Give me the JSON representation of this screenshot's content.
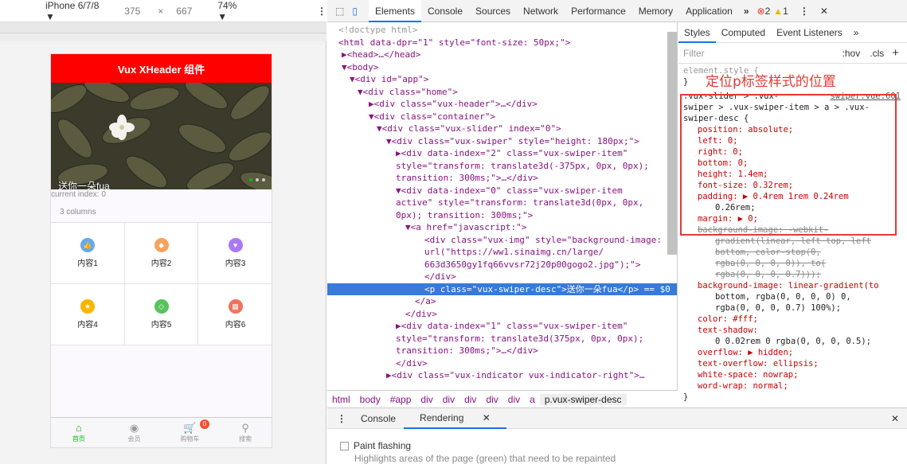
{
  "device_toolbar": {
    "device": "iPhone 6/7/8",
    "width": "375",
    "times": "×",
    "height": "667",
    "zoom": "74%",
    "more": "⋮"
  },
  "phone": {
    "header_title": "Vux XHeader 组件",
    "swiper_desc": "送你一朵fua",
    "current_index": "current index: 0",
    "columns_title": "3 columns",
    "grid": [
      {
        "label": "内容1",
        "icon": "thumb-up-icon",
        "color": "#65a8f4"
      },
      {
        "label": "内容2",
        "icon": "shape-icon",
        "color": "#f7a35c"
      },
      {
        "label": "内容3",
        "icon": "heart-icon",
        "color": "#a979f5"
      },
      {
        "label": "内容4",
        "icon": "star-icon",
        "color": "#f7b500"
      },
      {
        "label": "内容5",
        "icon": "diamond-icon",
        "color": "#58c25c"
      },
      {
        "label": "内容6",
        "icon": "grid-icon",
        "color": "#f0725c"
      }
    ],
    "tabbar": [
      {
        "label": "首页",
        "icon": "home-icon"
      },
      {
        "label": "会员",
        "icon": "user-icon"
      },
      {
        "label": "购物车",
        "icon": "cart-icon",
        "badge": "0"
      },
      {
        "label": "搜索",
        "icon": "search-icon"
      }
    ]
  },
  "devtools": {
    "tabs": [
      "Elements",
      "Console",
      "Sources",
      "Network",
      "Performance",
      "Memory",
      "Application"
    ],
    "more": "»",
    "errors": "2",
    "warnings": "1",
    "elements_lines": [
      "<!doctype html>",
      "<html data-dpr=\"1\" style=\"font-size: 50px;\">",
      "▶<head>…</head>",
      "▼<body>",
      "▼<div id=\"app\">",
      "▼<div class=\"home\">",
      "▶<div class=\"vux-header\">…</div>",
      "▼<div class=\"container\">",
      "▼<div class=\"vux-slider\" index=\"0\">",
      "▼<div class=\"vux-swiper\" style=\"height: 180px;\">",
      "▶<div data-index=\"2\" class=\"vux-swiper-item\"",
      "style=\"transform: translate3d(-375px, 0px, 0px);",
      "transition: 300ms;\">…</div>",
      "▼<div data-index=\"0\" class=\"vux-swiper-item",
      "active\" style=\"transform: translate3d(0px, 0px,",
      "0px); transition: 300ms;\">",
      "▼<a href=\"javascript:\">",
      "<div class=\"vux-img\" style=\"background-image:",
      "url(\"https://ww1.sinaimg.cn/large/",
      "663d3650gy1fq66vvsr72j20p00gogo2.jpg\");\">",
      "</div>",
      "<p class=\"vux-swiper-desc\">送你一朵fua</p> == $0",
      "</a>",
      "</div>",
      "▶<div data-index=\"1\" class=\"vux-swiper-item\"",
      "style=\"transform: translate3d(375px, 0px, 0px);",
      "transition: 300ms;\">…</div>",
      "</div>",
      "▶<div class=\"vux-indicator vux-indicator-right\">…"
    ],
    "breadcrumbs": [
      "html",
      "body",
      "#app",
      "div",
      "div",
      "div",
      "div",
      "div",
      "a",
      "p.vux-swiper-desc"
    ],
    "styles_tabs": [
      "Styles",
      "Computed",
      "Event Listeners",
      "»"
    ],
    "filter_placeholder": "Filter",
    "hov": ":hov",
    "cls": ".cls",
    "plus": "+",
    "annotation": "定位p标签样式的位置",
    "style_lines": [
      "element.style {",
      "}",
      ".vux-slider > .vux-",
      "swiper > .vux-swiper-item > a > .vux-",
      "swiper-desc {",
      "position: absolute;",
      "left: 0;",
      "right: 0;",
      "bottom: 0;",
      "height: 1.4em;",
      "font-size: 0.32rem;",
      "padding: ▶ 0.4rem 1rem 0.24rem",
      "0.26rem;",
      "margin: ▶ 0;",
      "background-image: -webkit-",
      "gradient(linear, left top, left",
      "bottom, color-stop(0,",
      "rgba(0, 0, 0, 0)), to(",
      "rgba(0, 0, 0, 0.7)));",
      "background-image: linear-gradient(to",
      "bottom, rgba(0, 0, 0, 0) 0,",
      "rgba(0, 0, 0, 0.7) 100%);",
      "color: #fff;",
      "text-shadow:",
      "0 0.02rem 0 rgba(0, 0, 0, 0.5);",
      "overflow: ▶ hidden;",
      "text-overflow: ellipsis;",
      "white-space: nowrap;",
      "word-wrap: normal;",
      "}"
    ],
    "source_link": "swiper.vue:601",
    "drawer_tabs": [
      "Console",
      "Rendering"
    ],
    "paint_flashing": "Paint flashing",
    "paint_flashing_desc": "Highlights areas of the page (green) that need to be repainted"
  }
}
